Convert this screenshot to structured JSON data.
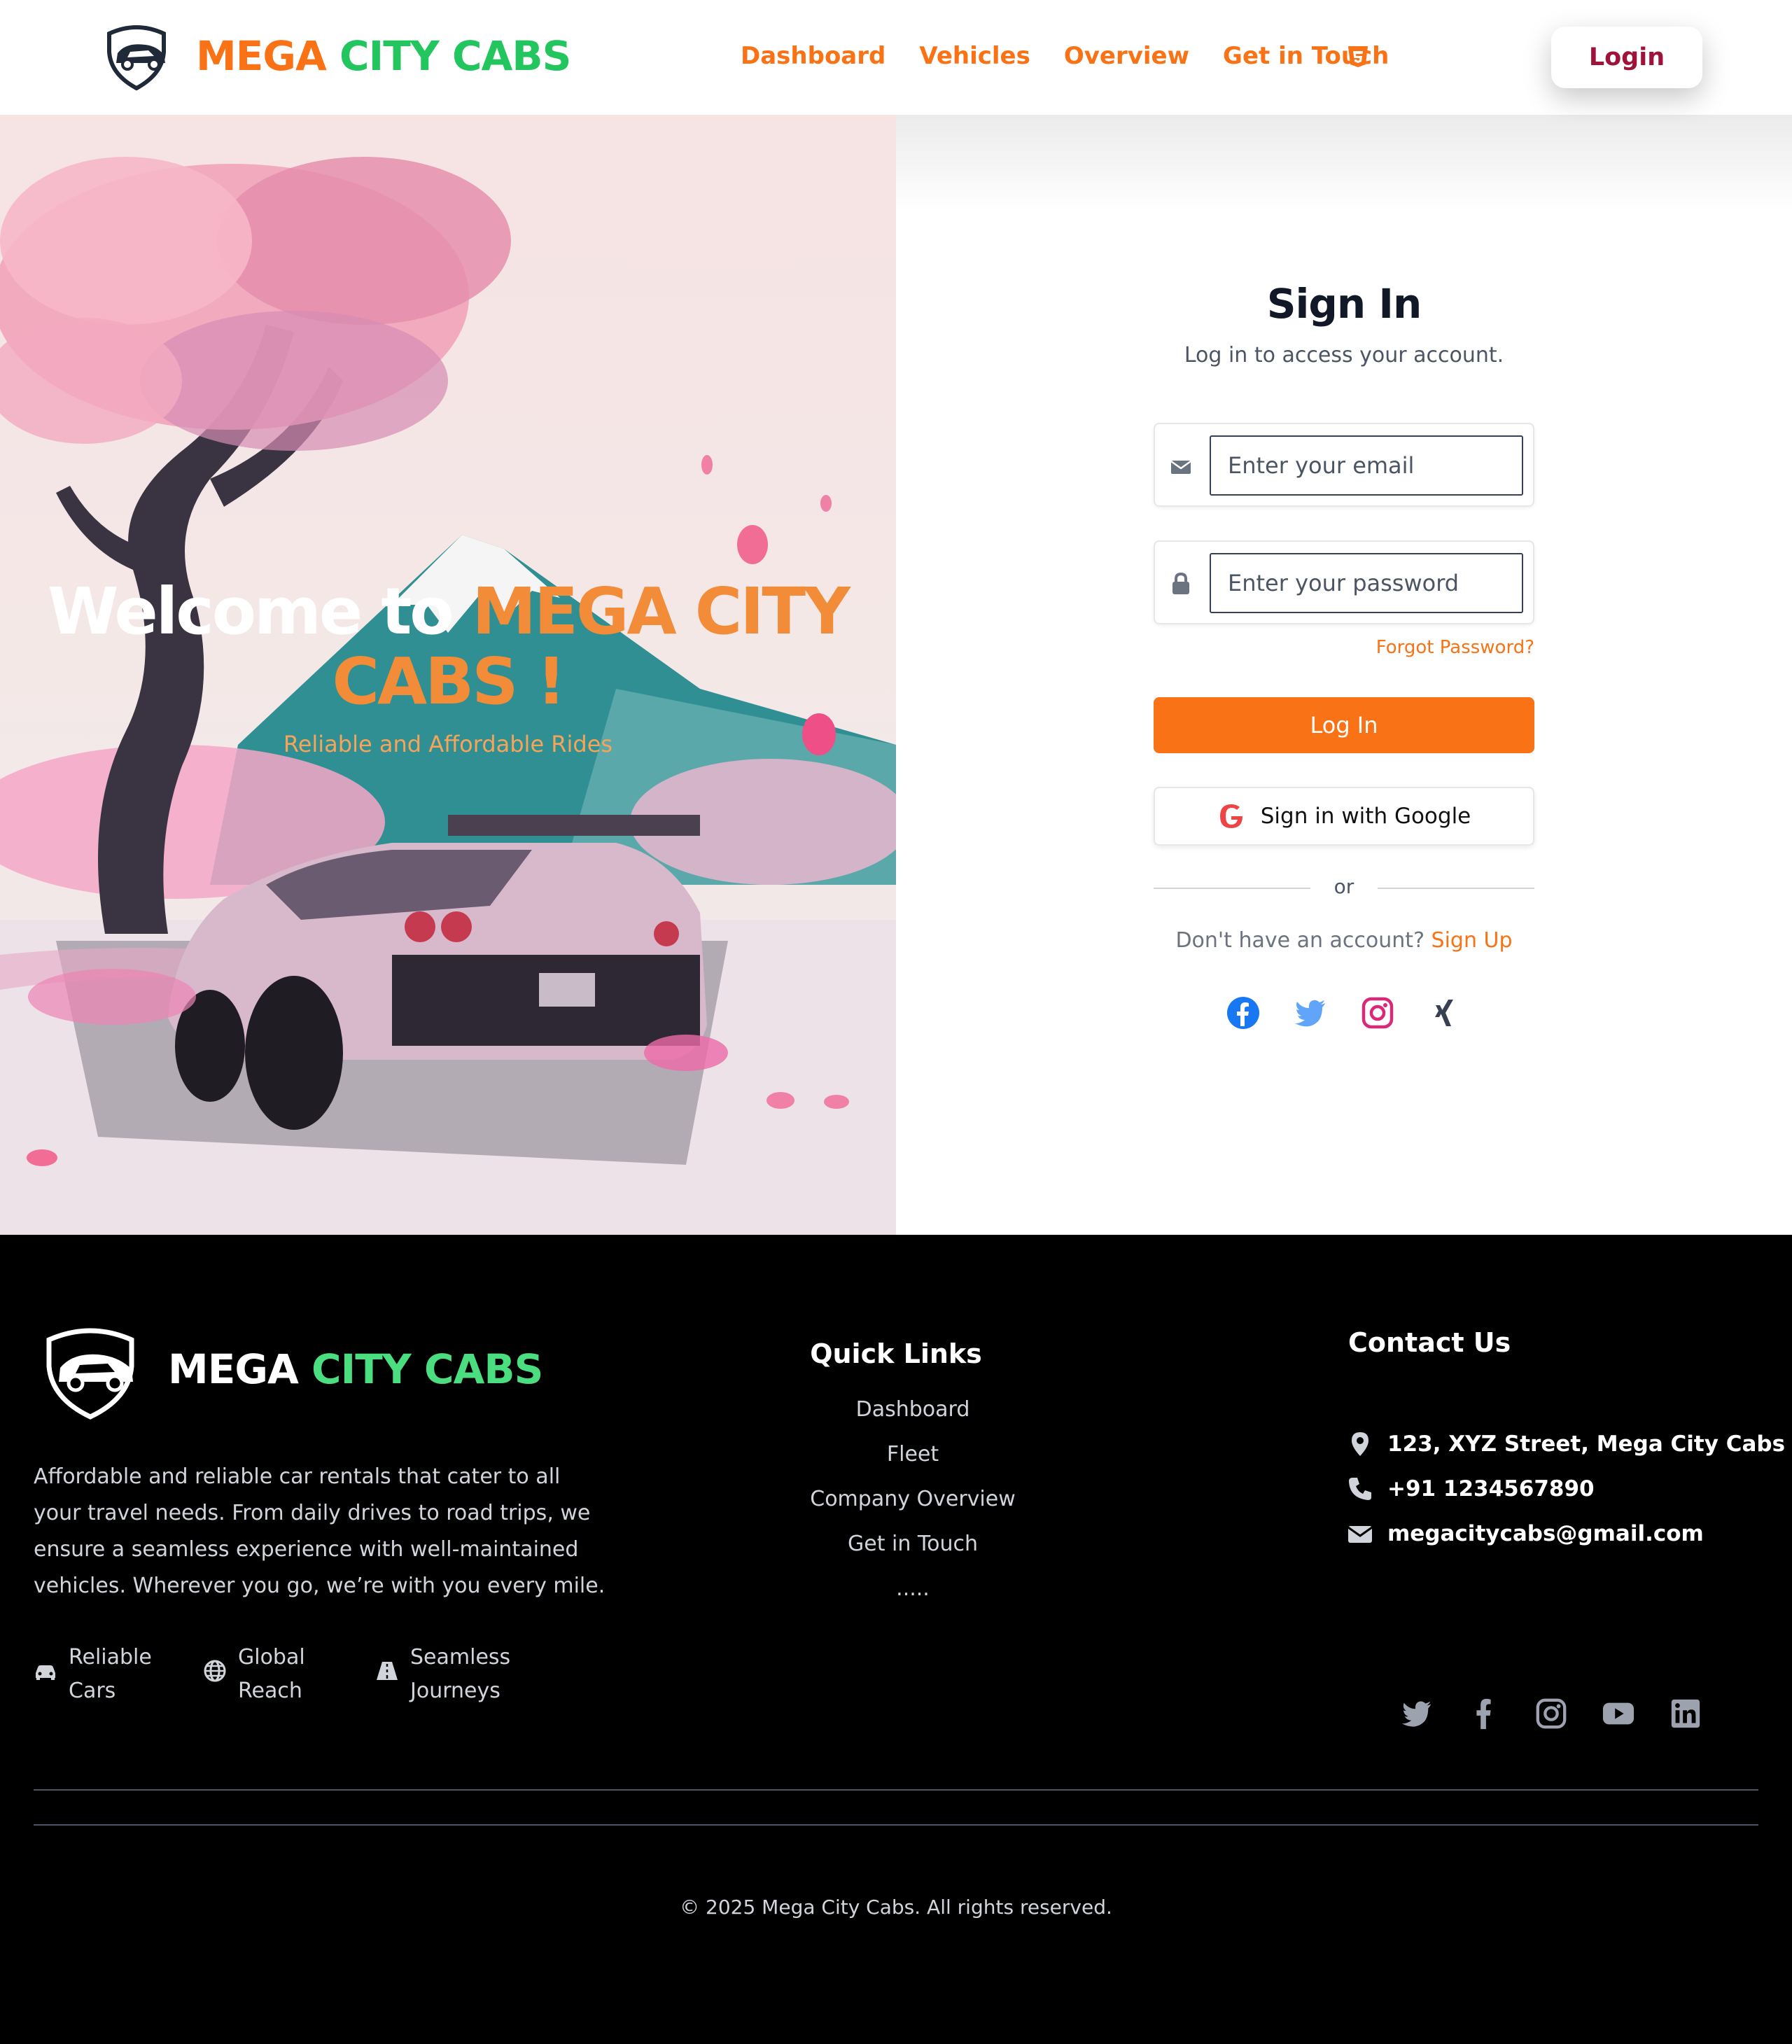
{
  "header": {
    "brand_part1": "MEGA",
    "brand_part2": "CITY CABS",
    "nav": [
      "Dashboard",
      "Vehicles",
      "Overview",
      "Get in Touch"
    ],
    "html5_icon": "html5-icon",
    "login_button": "Login"
  },
  "hero": {
    "welcome_prefix": "Welcome to ",
    "welcome_brand": "MEGA CITY CABS !",
    "tagline": "Reliable and Affordable Rides"
  },
  "signin": {
    "title": "Sign In",
    "subtitle": "Log in to access your account.",
    "email_placeholder": "Enter your email",
    "password_placeholder": "Enter your password",
    "forgot": "Forgot Password?",
    "login_button": "Log In",
    "google_button": "Sign in with Google",
    "divider": "or",
    "no_account": "Don't have an account?",
    "signup_link": "Sign Up",
    "social_icons": [
      "facebook-icon",
      "twitter-icon",
      "instagram-icon",
      "xing-icon"
    ]
  },
  "footer": {
    "brand_part1": "MEGA",
    "brand_part2": "CITY CABS",
    "description": "Affordable and reliable car rentals that cater to all your travel needs. From daily drives to road trips, we ensure a seamless experience with well-maintained vehicles. Wherever you go, we’re with you every mile.",
    "features": [
      {
        "line1": "Reliable",
        "line2": "Cars",
        "icon": "car-icon"
      },
      {
        "line1": "Global",
        "line2": "Reach",
        "icon": "globe-icon"
      },
      {
        "line1": "Seamless",
        "line2": "Journeys",
        "icon": "road-icon"
      }
    ],
    "quick_links_title": "Quick Links",
    "quick_links": [
      "Dashboard",
      "Fleet",
      "Company Overview",
      "Get in Touch",
      "....."
    ],
    "contact_title": "Contact Us",
    "address": "123, XYZ Street, Mega City Cabs",
    "phone": "+91 1234567890",
    "email": "megacitycabs@gmail.com",
    "social_icons": [
      "twitter-icon",
      "facebook-icon",
      "instagram-icon",
      "youtube-icon",
      "linkedin-icon"
    ],
    "copyright": "© 2025 Mega City Cabs. All rights reserved."
  },
  "colors": {
    "accent_orange": "#f97316",
    "brand_green": "#22c55e",
    "login_text": "#9f1239",
    "footer_bg": "#000000"
  }
}
